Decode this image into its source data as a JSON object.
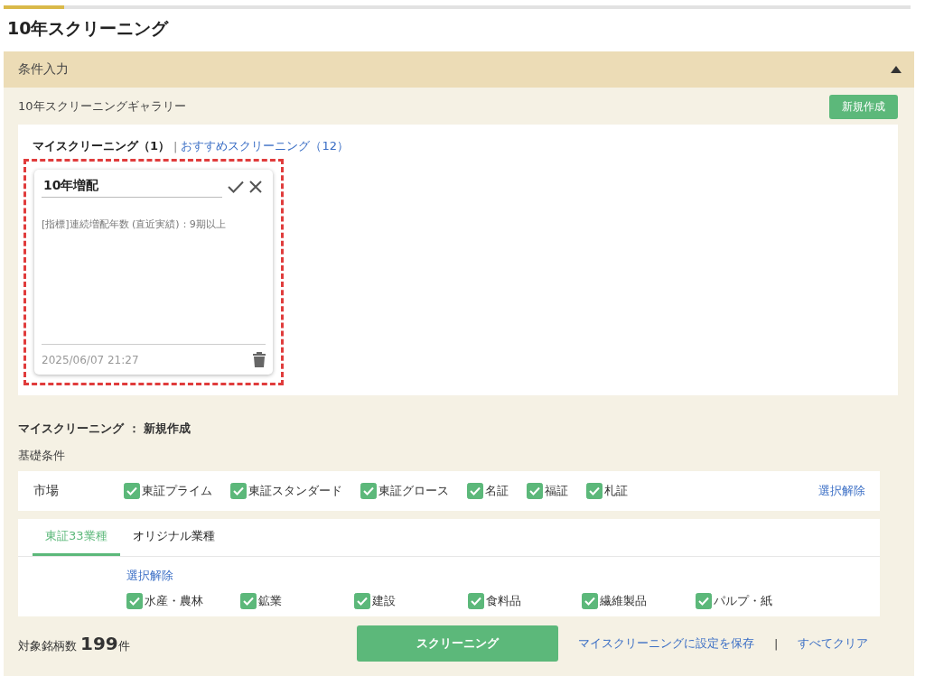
{
  "progress": {
    "level": 0.067
  },
  "page_title": "10年スクリーニング",
  "accordion": {
    "title": "条件入力",
    "expanded": true
  },
  "gallery": {
    "title": "10年スクリーニングギャラリー",
    "new_button": "新規作成",
    "tab_separator": "|",
    "tabs": [
      {
        "label": "マイスクリーニング（1）",
        "selected": true
      },
      {
        "label": "おすすめスクリーニング（12）",
        "selected": false
      }
    ],
    "cards": [
      {
        "title": "10年増配",
        "condition": "[指標]連続増配年数 (直近実績)：9期以上",
        "date": "2025/06/07 21:27",
        "highlighted": true
      }
    ]
  },
  "editor": {
    "heading": "マイスクリーニング ： 新規作成",
    "section": "基礎条件",
    "market": {
      "label": "市場",
      "clear": "選択解除",
      "options": [
        {
          "label": "東証プライム",
          "checked": true
        },
        {
          "label": "東証スタンダード",
          "checked": true
        },
        {
          "label": "東証グロース",
          "checked": true
        },
        {
          "label": "名証",
          "checked": true
        },
        {
          "label": "福証",
          "checked": true
        },
        {
          "label": "札証",
          "checked": true
        }
      ]
    },
    "industry": {
      "tabs": [
        {
          "label": "東証33業種",
          "selected": true
        },
        {
          "label": "オリジナル業種",
          "selected": false
        }
      ],
      "clear": "選択解除",
      "options": [
        {
          "label": "水産・農林",
          "checked": true
        },
        {
          "label": "鉱業",
          "checked": true
        },
        {
          "label": "建設",
          "checked": true
        },
        {
          "label": "食料品",
          "checked": true
        },
        {
          "label": "繊維製品",
          "checked": true
        },
        {
          "label": "パルプ・紙",
          "checked": true
        }
      ]
    }
  },
  "footer": {
    "count_label": "対象銘柄数",
    "count": "199",
    "count_unit": "件",
    "run_button": "スクリーニング",
    "save_link": "マイスクリーニングに設定を保存",
    "separator": "|",
    "clear_link": "すべてクリア"
  }
}
